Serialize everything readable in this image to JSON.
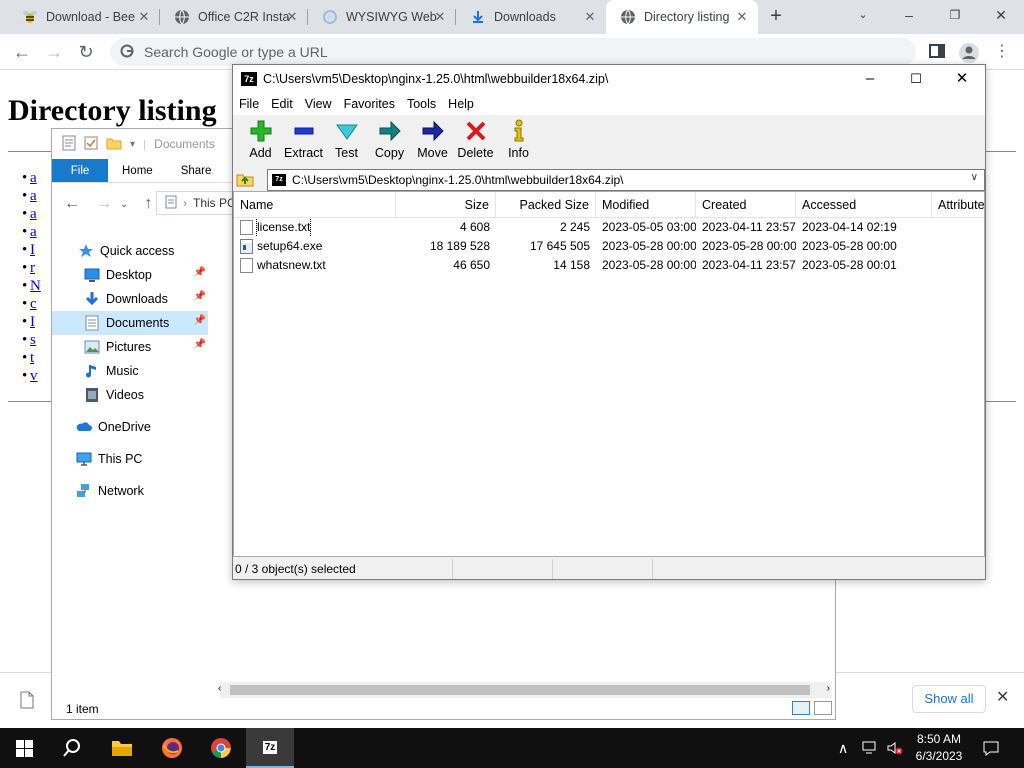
{
  "chrome": {
    "tabs": [
      {
        "title": "Download - Bee",
        "icon": "bee-icon"
      },
      {
        "title": "Office C2R Insta",
        "icon": "globe-icon"
      },
      {
        "title": "WYSIWYG Web",
        "icon": "spinner-icon"
      },
      {
        "title": "Downloads",
        "icon": "download-icon"
      },
      {
        "title": "Directory listing",
        "icon": "globe-icon"
      }
    ],
    "active_tab": 4,
    "omnibox_placeholder": "Search Google or type a URL",
    "accent": "#1a73e8"
  },
  "page": {
    "title": "Directory listing",
    "links": [
      "a",
      "a",
      "a",
      "a",
      "I",
      "r",
      "N",
      "c",
      "I",
      "s",
      "t",
      "v"
    ]
  },
  "download_bar": {
    "show_all": "Show all"
  },
  "explorer": {
    "location": "Documents",
    "ribbon_tabs": [
      "File",
      "Home",
      "Share"
    ],
    "breadcrumb": "This PC",
    "nav": [
      {
        "label": "Quick access",
        "icon": "star-icon"
      },
      {
        "label": "Desktop",
        "icon": "desktop-icon",
        "pinned": true
      },
      {
        "label": "Downloads",
        "icon": "download-arrow-icon",
        "pinned": true
      },
      {
        "label": "Documents",
        "icon": "document-icon",
        "pinned": true,
        "selected": true
      },
      {
        "label": "Pictures",
        "icon": "pictures-icon",
        "pinned": true
      },
      {
        "label": "Music",
        "icon": "music-icon"
      },
      {
        "label": "Videos",
        "icon": "video-icon"
      },
      {
        "label": "OneDrive",
        "icon": "cloud-icon"
      },
      {
        "label": "This PC",
        "icon": "computer-icon"
      },
      {
        "label": "Network",
        "icon": "network-icon"
      }
    ],
    "status": "1 item"
  },
  "sevenzip": {
    "title": "C:\\Users\\vm5\\Desktop\\nginx-1.25.0\\html\\webbuilder18x64.zip\\",
    "menu": [
      "File",
      "Edit",
      "View",
      "Favorites",
      "Tools",
      "Help"
    ],
    "toolbar": [
      {
        "label": "Add",
        "icon": "plus-icon"
      },
      {
        "label": "Extract",
        "icon": "minus-icon"
      },
      {
        "label": "Test",
        "icon": "check-icon"
      },
      {
        "label": "Copy",
        "icon": "copy-arrow-icon"
      },
      {
        "label": "Move",
        "icon": "move-arrow-icon"
      },
      {
        "label": "Delete",
        "icon": "delete-x-icon"
      },
      {
        "label": "Info",
        "icon": "info-icon"
      }
    ],
    "address": "C:\\Users\\vm5\\Desktop\\nginx-1.25.0\\html\\webbuilder18x64.zip\\",
    "columns": [
      "Name",
      "Size",
      "Packed Size",
      "Modified",
      "Created",
      "Accessed",
      "Attribute"
    ],
    "rows": [
      {
        "name": "license.txt",
        "size": "4 608",
        "packed": "2 245",
        "modified": "2023-05-05 03:00",
        "created": "2023-04-11 23:57",
        "accessed": "2023-04-14 02:19",
        "type": "txt"
      },
      {
        "name": "setup64.exe",
        "size": "18 189 528",
        "packed": "17 645 505",
        "modified": "2023-05-28 00:00",
        "created": "2023-05-28 00:00",
        "accessed": "2023-05-28 00:00",
        "type": "exe"
      },
      {
        "name": "whatsnew.txt",
        "size": "46 650",
        "packed": "14 158",
        "modified": "2023-05-28 00:00",
        "created": "2023-04-11 23:57",
        "accessed": "2023-05-28 00:01",
        "type": "txt"
      }
    ],
    "status": "0 / 3 object(s) selected"
  },
  "taskbar": {
    "time": "8:50 AM",
    "date": "6/3/2023"
  }
}
